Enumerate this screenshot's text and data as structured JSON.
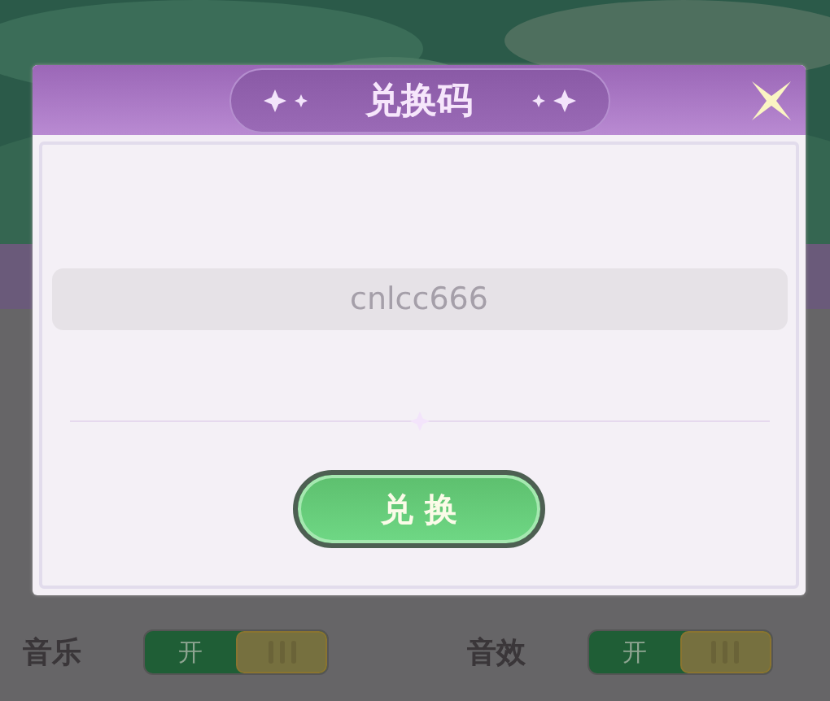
{
  "dialog": {
    "title": "兑换码",
    "code_field": {
      "value": "cnlcc666"
    },
    "button": "兑 换"
  },
  "settings": [
    {
      "label": "音乐",
      "switch_text": "开",
      "on": true
    },
    {
      "label": "音效",
      "switch_text": "开",
      "on": true
    }
  ]
}
